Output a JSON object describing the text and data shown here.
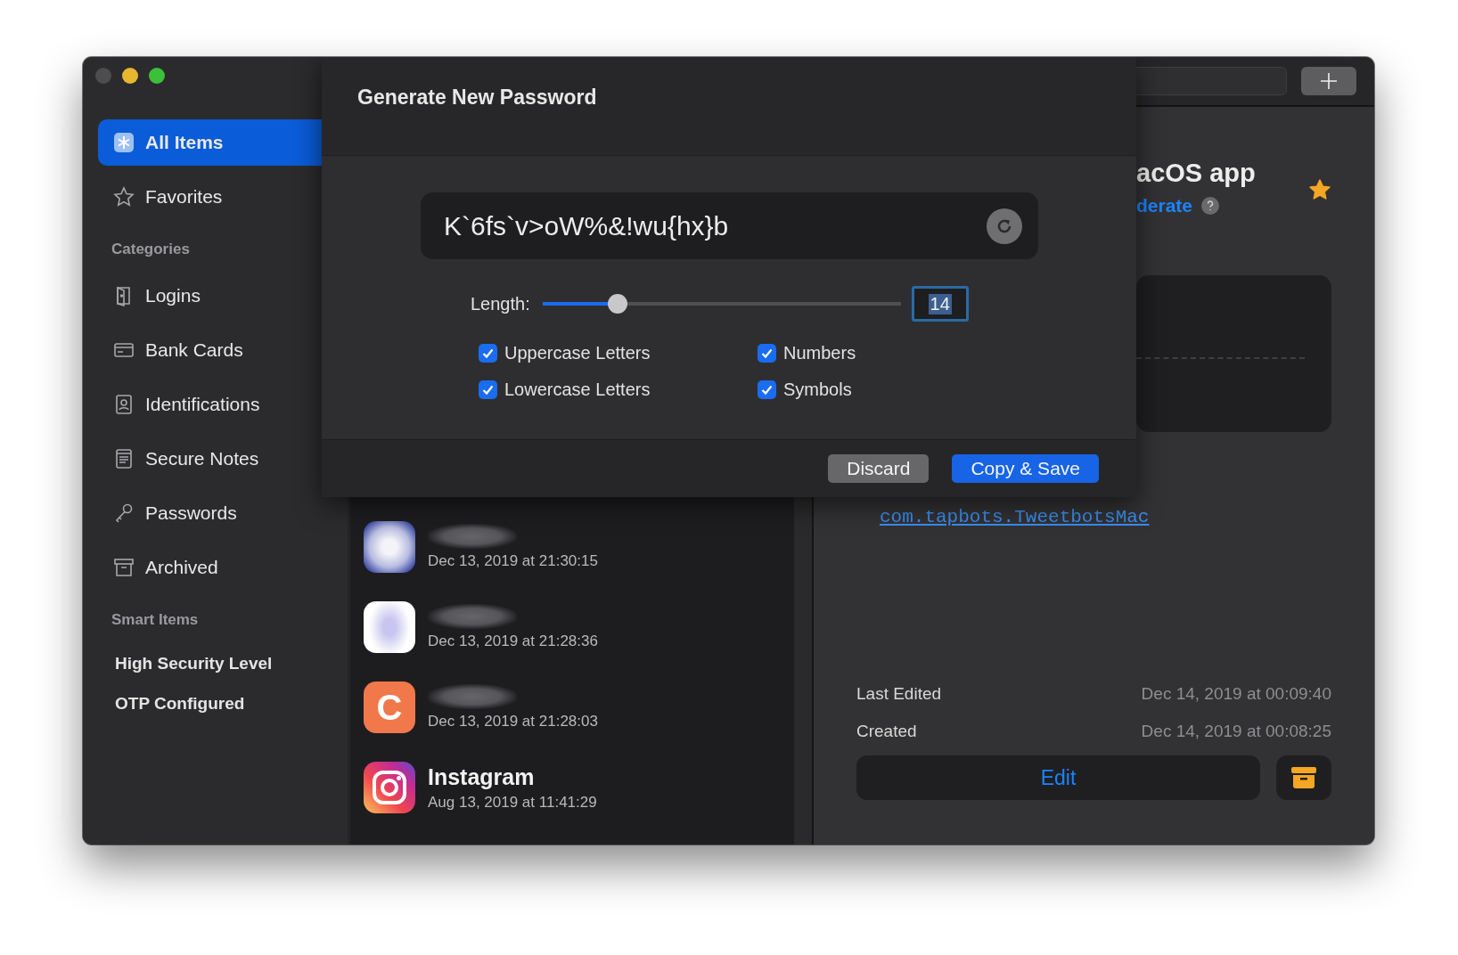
{
  "sidebar": {
    "top_items": [
      {
        "label": "All Items",
        "selected": true
      },
      {
        "label": "Favorites",
        "selected": false
      }
    ],
    "categories": {
      "heading": "Categories",
      "items": [
        {
          "label": "Logins",
          "selected": false
        },
        {
          "label": "Bank Cards",
          "selected": false
        },
        {
          "label": "Identifications",
          "selected": false
        },
        {
          "label": "Secure Notes",
          "selected": false
        },
        {
          "label": "Passwords",
          "selected": false
        },
        {
          "label": "Archived",
          "selected": false
        }
      ]
    },
    "smart_items": {
      "heading": "Smart Items",
      "items": [
        {
          "label": "High Security Level",
          "selected": false
        },
        {
          "label": "OTP Configured",
          "selected": false
        }
      ]
    }
  },
  "list": {
    "rows": [
      {
        "kind": "blurred-blue",
        "date": "Dec 13, 2019 at 21:30:15"
      },
      {
        "kind": "blurred-white",
        "date": "Dec 13, 2019 at 21:28:36"
      },
      {
        "kind": "letter",
        "icon_letter": "C",
        "date": "Dec 13, 2019 at 21:28:03"
      },
      {
        "kind": "camera",
        "title": "Instagram",
        "date": "Aug 13, 2019 at 11:41:29"
      }
    ]
  },
  "detail": {
    "title": "acOS app",
    "strength": "derate",
    "favorite": true,
    "link": "com.tapbots.TweetbotsMac",
    "meta": [
      {
        "label": "Last Edited",
        "value": "Dec 14, 2019 at 00:09:40"
      },
      {
        "label": "Created",
        "value": "Dec 14, 2019 at 00:08:25"
      }
    ],
    "edit_button": "Edit"
  },
  "dialog": {
    "title": "Generate New Password",
    "password": "K`6fs`v>oW%&!wu{hx}b",
    "length_label": "Length:",
    "length": "14",
    "level": 0.21,
    "options": [
      {
        "label": "Uppercase Letters",
        "checked": true
      },
      {
        "label": "Numbers",
        "checked": true
      },
      {
        "label": "Lowercase Letters",
        "checked": true
      },
      {
        "label": "Symbols",
        "checked": true
      }
    ],
    "buttons": [
      {
        "label": "Discard",
        "kind": "secondary"
      },
      {
        "label": "Copy & Save",
        "kind": "primary"
      }
    ]
  }
}
